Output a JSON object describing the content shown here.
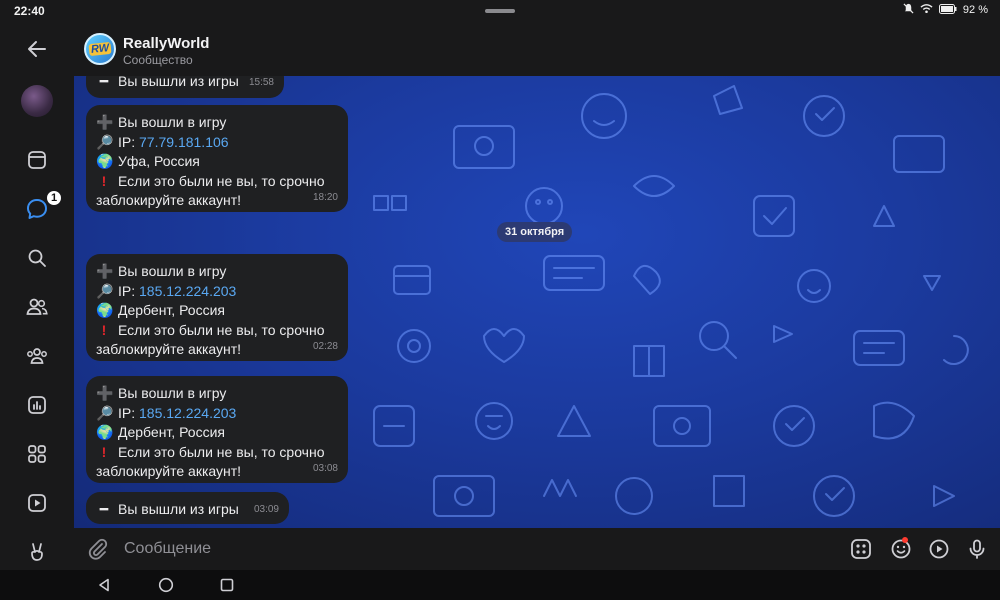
{
  "status_bar": {
    "time": "22:40",
    "battery": "92 %"
  },
  "header": {
    "title": "ReallyWorld",
    "subtitle": "Сообщество",
    "logo_text": "RW"
  },
  "rail": {
    "badge_count": "1"
  },
  "chat": {
    "date_separator": "31 октября",
    "messages": [
      {
        "type": "exit",
        "icon": "minus-icon",
        "text": "Вы вышли из игры",
        "time": "15:58"
      },
      {
        "type": "login",
        "line1": "Вы вошли в игру",
        "ip_label": "IP:",
        "ip": "77.79.181.106",
        "location": "Уфа, Россия",
        "warning1": "Если это были не вы, то срочно",
        "warning2": "заблокируйте аккаунт!",
        "time": "18:20"
      },
      {
        "type": "login",
        "line1": "Вы вошли в игру",
        "ip_label": "IP:",
        "ip": "185.12.224.203",
        "location": "Дербент, Россия",
        "warning1": "Если это были не вы, то срочно",
        "warning2": "заблокируйте аккаунт!",
        "time": "02:28"
      },
      {
        "type": "login",
        "line1": "Вы вошли в игру",
        "ip_label": "IP:",
        "ip": "185.12.224.203",
        "location": "Дербент, Россия",
        "warning1": "Если это были не вы, то срочно",
        "warning2": "заблокируйте аккаунт!",
        "time": "03:08"
      },
      {
        "type": "exit",
        "icon": "minus-icon",
        "text": "Вы вышли из игры",
        "time": "03:09"
      }
    ]
  },
  "composer": {
    "placeholder": "Сообщение"
  },
  "colors": {
    "chat_bg": "#1b3a9e",
    "bubble": "#1f2022",
    "link": "#5aa8f2",
    "warning": "#e0262b"
  }
}
